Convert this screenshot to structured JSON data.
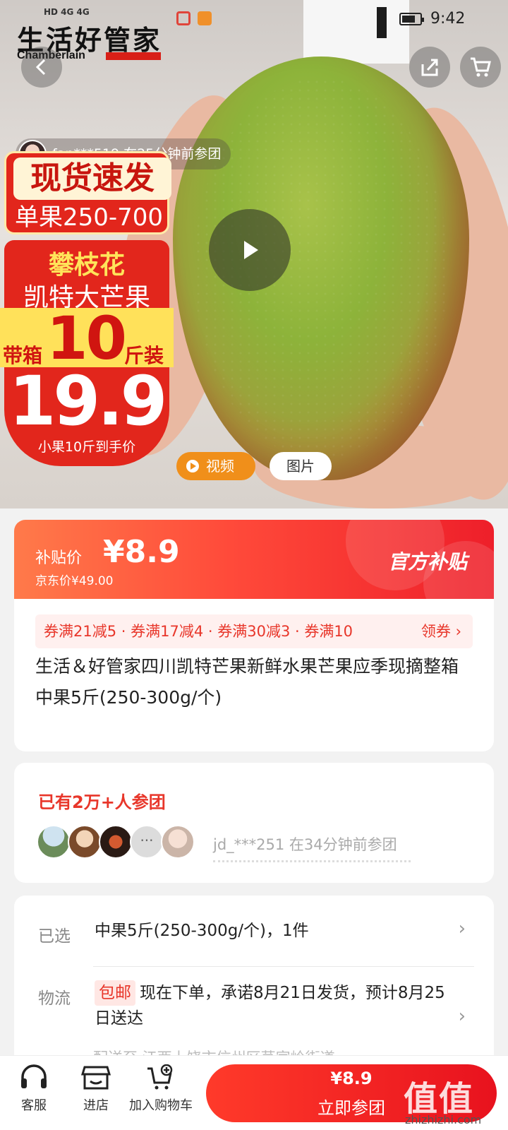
{
  "status_bar": {
    "network": "HD 4G 4G",
    "time": "9:42"
  },
  "brand": {
    "name_cn": "生活好管家",
    "name_en": "Chamberlain"
  },
  "hero": {
    "buyer_notice": "fan***519  在25分钟前参团",
    "promo": {
      "line1": "现货速发",
      "line2": "单果250-700",
      "line3": "攀枝花",
      "line4": "凯特大芒果",
      "line5_prefix": "带箱",
      "line5_number": "10",
      "line5_suffix": "斤装",
      "big_price": "19.9",
      "footnote": "小果10斤到手价"
    },
    "tabs": {
      "video": "视频",
      "image": "图片"
    }
  },
  "price": {
    "subsidy_label": "补贴价",
    "subsidy_price": "¥8.9",
    "jd_price": "京东价¥49.00",
    "official_badge": "官方补贴"
  },
  "coupons": {
    "text": "券满21减5 · 券满17减4 · 券满30减3 · 券满10",
    "action": "领券 ›"
  },
  "product": {
    "title": "生活＆好管家四川凯特芒果新鲜水果芒果应季现摘整箱 中果5斤(250-300g/个)"
  },
  "group": {
    "title": "已有2万+人参团",
    "more": "···",
    "latest": "jd_***251 在34分钟前参团"
  },
  "spec": {
    "selected_label": "已选",
    "selected_value": "中果5斤(250-300g/个)，1件",
    "logistics_label": "物流",
    "free_shipping": "包邮",
    "logistics_value": "现在下单，承诺8月21日发货，预计8月25日送达",
    "arrow": "›",
    "ship_from": "配送至  江西上饶市信州区茅家岭街道"
  },
  "bottom_bar": {
    "service": "客服",
    "store": "进店",
    "add_cart": "加入购物车",
    "cta_price": "¥8.9",
    "cta_label": "立即参团"
  },
  "watermark": {
    "main": "值值值",
    "sub": "zhizhizhi.com"
  },
  "colors": {
    "accent": "#e8362a",
    "orange": "#f08f1a"
  }
}
